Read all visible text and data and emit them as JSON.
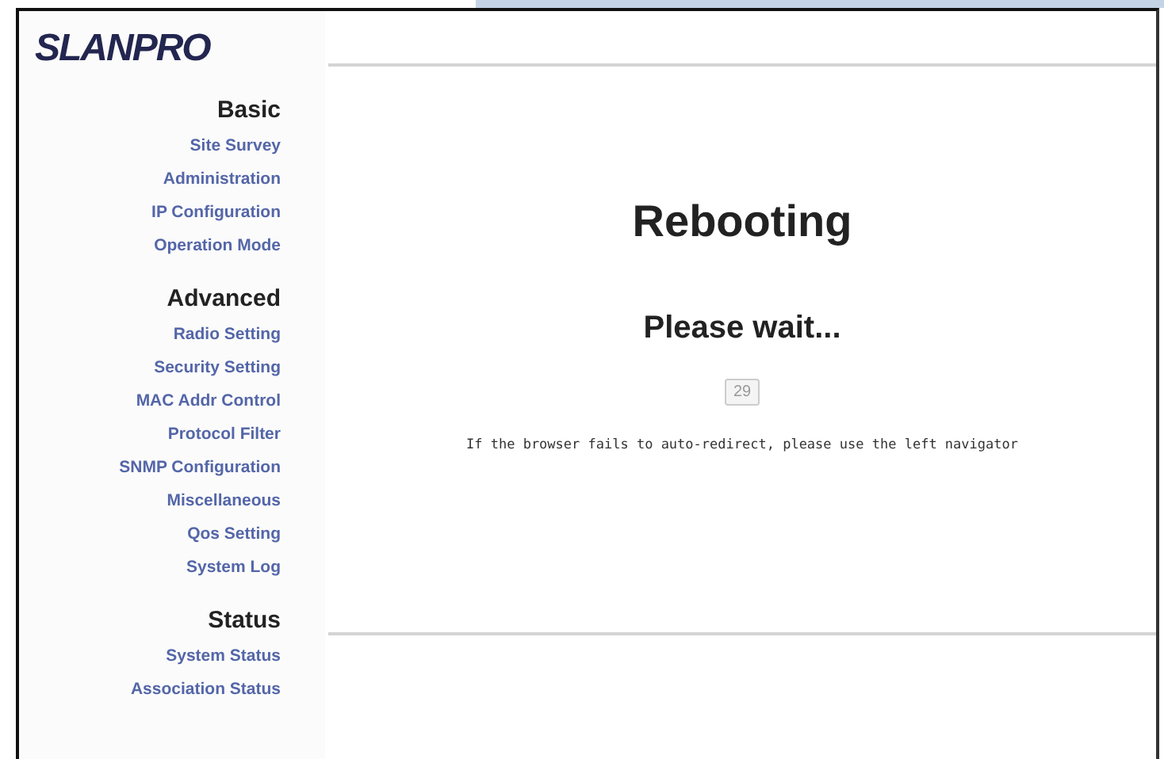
{
  "logo": {
    "text": "SLANPRO"
  },
  "sidebar": {
    "sections": [
      {
        "heading": "Basic",
        "items": [
          "Site Survey",
          "Administration",
          "IP Configuration",
          "Operation Mode"
        ]
      },
      {
        "heading": "Advanced",
        "items": [
          "Radio Setting",
          "Security Setting",
          "MAC Addr Control",
          "Protocol Filter",
          "SNMP Configuration",
          "Miscellaneous",
          "Qos Setting",
          "System Log"
        ]
      },
      {
        "heading": "Status",
        "items": [
          "System Status",
          "Association Status"
        ]
      }
    ]
  },
  "main": {
    "title": "Rebooting",
    "subtitle": "Please wait...",
    "countdown": "29",
    "message": "If the browser fails to auto-redirect, please use the left navigator"
  }
}
